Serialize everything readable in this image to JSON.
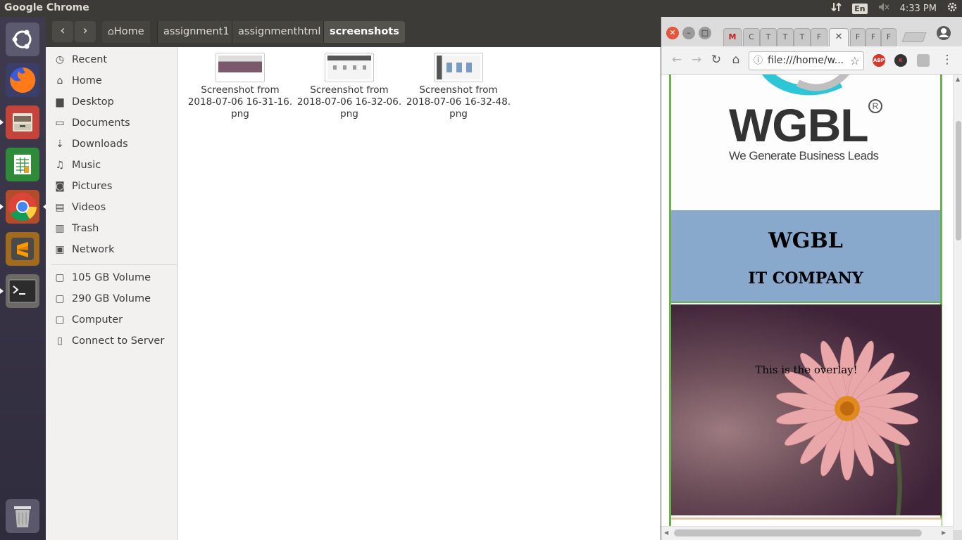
{
  "top_panel": {
    "app_title": "Google Chrome",
    "language": "En",
    "clock": "4:33 PM"
  },
  "launcher": {
    "items": [
      "ubuntu-dash",
      "firefox",
      "files",
      "libreoffice-calc",
      "chrome",
      "sublime-text",
      "terminal",
      "trash"
    ]
  },
  "files": {
    "breadcrumbs": [
      "Home",
      "assignment1",
      "assignmenthtml",
      "screenshots"
    ],
    "sidebar": [
      {
        "label": "Recent",
        "icon": "clock-icon"
      },
      {
        "label": "Home",
        "icon": "home-icon"
      },
      {
        "label": "Desktop",
        "icon": "folder-icon"
      },
      {
        "label": "Documents",
        "icon": "document-icon"
      },
      {
        "label": "Downloads",
        "icon": "download-icon"
      },
      {
        "label": "Music",
        "icon": "music-icon"
      },
      {
        "label": "Pictures",
        "icon": "camera-icon"
      },
      {
        "label": "Videos",
        "icon": "video-icon"
      },
      {
        "label": "Trash",
        "icon": "trash-icon"
      },
      {
        "label": "Network",
        "icon": "network-icon"
      }
    ],
    "devices": [
      {
        "label": "105 GB Volume",
        "icon": "drive-icon"
      },
      {
        "label": "290 GB Volume",
        "icon": "drive-icon"
      },
      {
        "label": "Computer",
        "icon": "computer-icon"
      },
      {
        "label": "Connect to Server",
        "icon": "server-icon"
      }
    ],
    "items": [
      {
        "line1": "Screenshot from",
        "line2": "2018-07-06 16-31-16.",
        "line3": "png"
      },
      {
        "line1": "Screenshot from",
        "line2": "2018-07-06 16-32-06.",
        "line3": "png"
      },
      {
        "line1": "Screenshot from",
        "line2": "2018-07-06 16-32-48.",
        "line3": "png"
      }
    ]
  },
  "chrome": {
    "tabs": [
      "M",
      "C",
      "T",
      "T",
      "T",
      "F",
      "",
      "F",
      "F",
      "F"
    ],
    "address": "file:///home/w...",
    "extensions": [
      "ABP",
      "K"
    ]
  },
  "webpage": {
    "logo_text": "WGBL",
    "logo_tagline": "We Generate Business Leads",
    "logo_mark": "R",
    "heading": "WGBL",
    "subheading": "IT COMPANY",
    "overlay_text": "This is the overlay!"
  },
  "colors": {
    "ubuntu_panel": "#3c3b37",
    "header_band": "#88a8cc",
    "page_border": "#6ab04c",
    "active_breadcrumb": "#55534d"
  }
}
